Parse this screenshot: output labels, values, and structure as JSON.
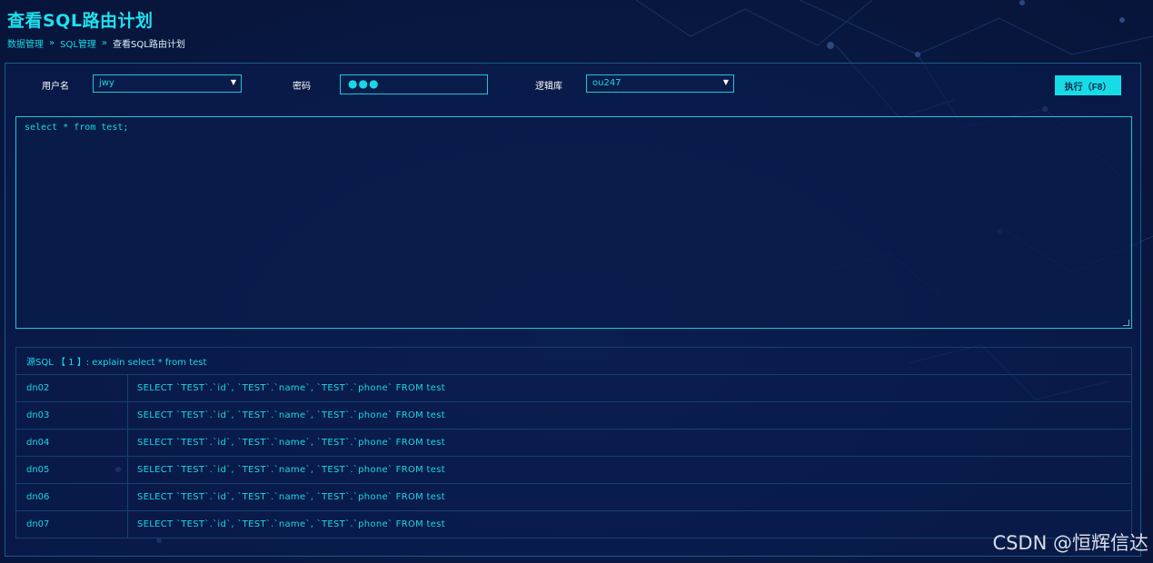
{
  "page": {
    "title": "查看SQL路由计划",
    "breadcrumb": [
      "数据管理",
      "SQL管理",
      "查看SQL路由计划"
    ]
  },
  "form": {
    "username_label": "用户名",
    "username_value": "jwy",
    "password_label": "密码",
    "password_value": "●●●",
    "logic_db_label": "逻辑库",
    "logic_db_value": "ou247",
    "run_button": "执行（F8）"
  },
  "editor": {
    "sql": "select * from test;"
  },
  "result": {
    "header": "源SQL 【 1 】: explain select * from test",
    "rows": [
      {
        "node": "dn02",
        "sql": "SELECT `TEST`.`id`, `TEST`.`name`, `TEST`.`phone` FROM test"
      },
      {
        "node": "dn03",
        "sql": "SELECT `TEST`.`id`, `TEST`.`name`, `TEST`.`phone` FROM test"
      },
      {
        "node": "dn04",
        "sql": "SELECT `TEST`.`id`, `TEST`.`name`, `TEST`.`phone` FROM test"
      },
      {
        "node": "dn05",
        "sql": "SELECT `TEST`.`id`, `TEST`.`name`, `TEST`.`phone` FROM test"
      },
      {
        "node": "dn06",
        "sql": "SELECT `TEST`.`id`, `TEST`.`name`, `TEST`.`phone` FROM test"
      },
      {
        "node": "dn07",
        "sql": "SELECT `TEST`.`id`, `TEST`.`name`, `TEST`.`phone` FROM test"
      }
    ]
  },
  "watermark": "CSDN @恒辉信达",
  "colors": {
    "accent": "#19d8e6",
    "background": "#0a1a44",
    "border": "#17406e"
  },
  "icons": {
    "breadcrumb_separator": "double-chevron-right-icon",
    "select_caret": "caret-down-icon"
  }
}
